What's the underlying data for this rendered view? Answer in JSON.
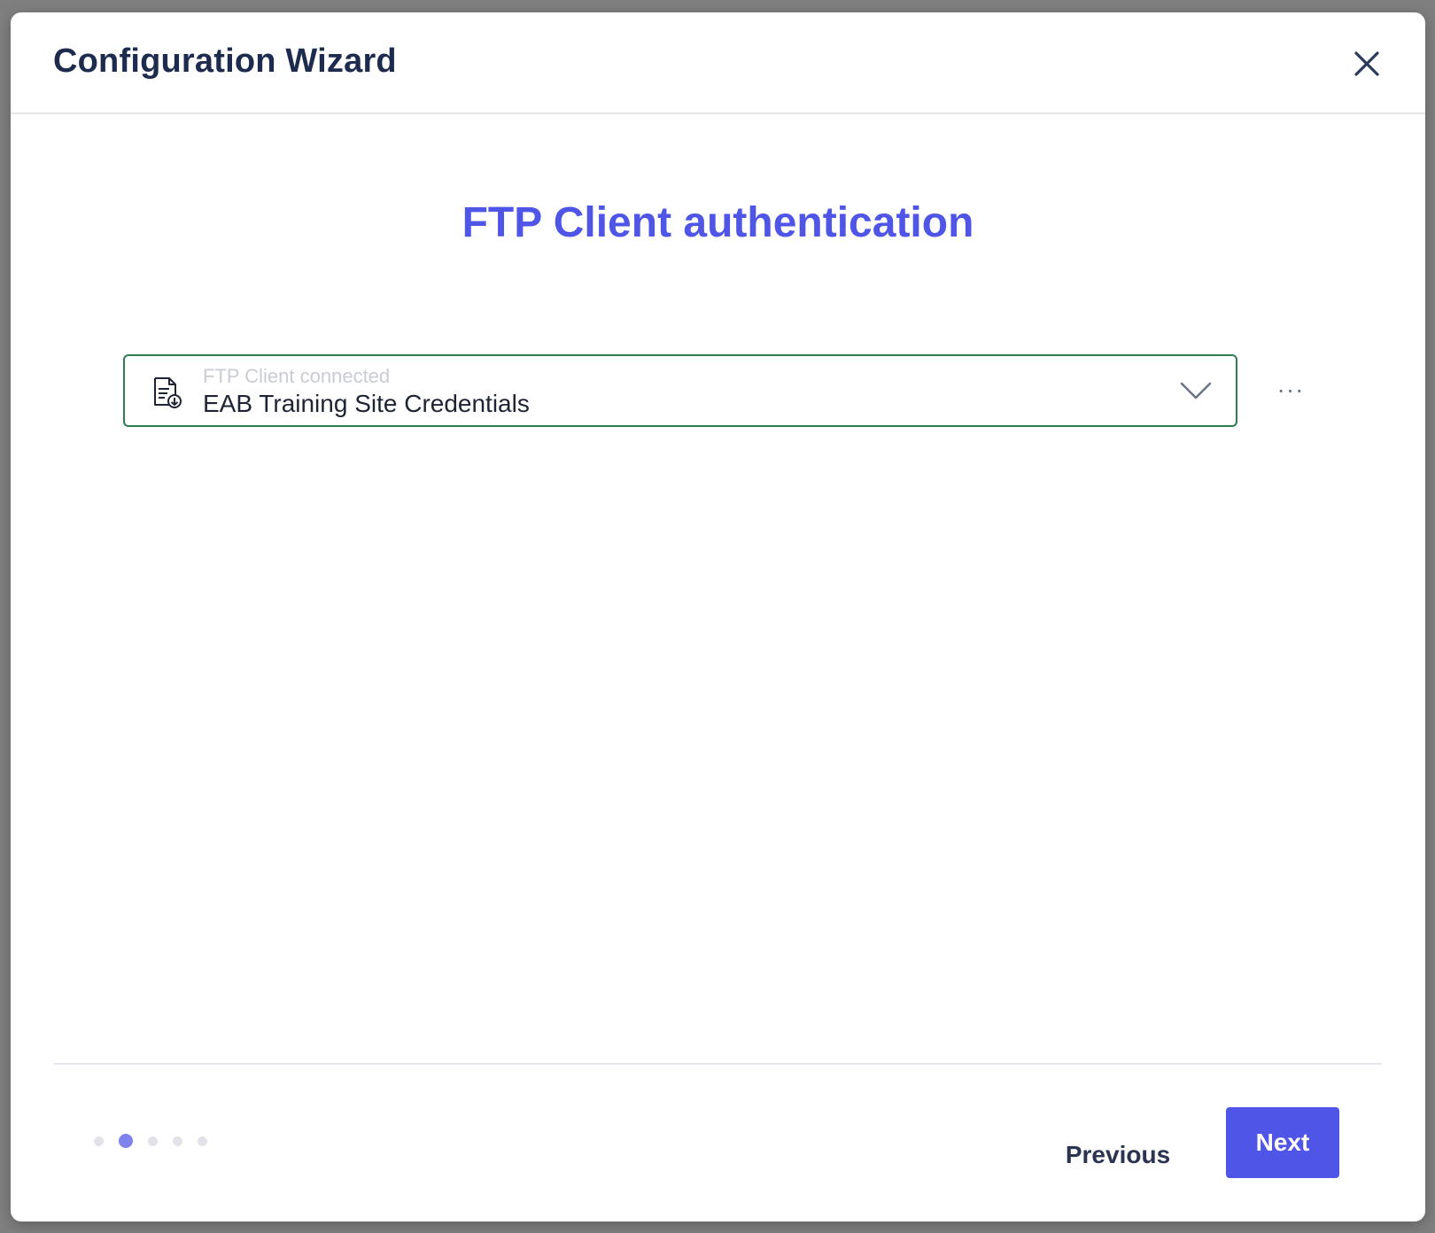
{
  "dialog": {
    "title": "Configuration Wizard",
    "close_icon": "close-icon"
  },
  "step": {
    "title": "FTP Client authentication"
  },
  "connection_select": {
    "label": "FTP Client connected",
    "value": "EAB Training Site Credentials",
    "icon": "document-download-icon",
    "chevron_icon": "chevron-down-icon",
    "more_label": "···"
  },
  "footer": {
    "steps_total": 5,
    "current_step": 2,
    "previous_label": "Previous",
    "next_label": "Next"
  },
  "colors": {
    "accent": "#4f55e6",
    "title_text": "#1d2b4f",
    "select_border": "#2e7d4f",
    "dot_active": "#7f84ec",
    "dot_inactive": "#e2e3e8"
  }
}
